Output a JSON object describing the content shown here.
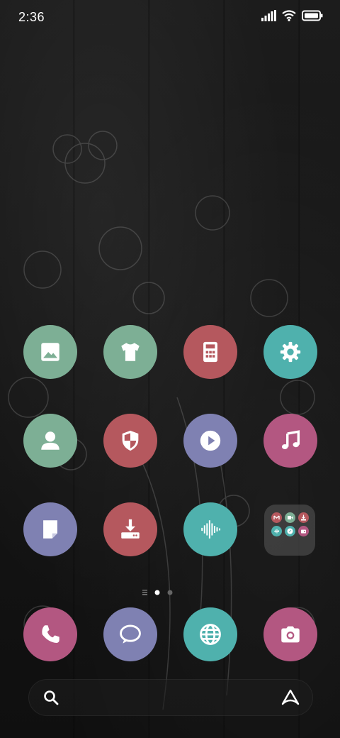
{
  "status_bar": {
    "time": "2:36",
    "icons": [
      "signal-icon",
      "wifi-icon",
      "battery-icon"
    ]
  },
  "colors": {
    "green": "#7daf95",
    "red": "#b5585e",
    "teal": "#4fb1ad",
    "purple": "#7f81b2",
    "pink": "#b35781"
  },
  "apps": [
    {
      "icon": "gallery-icon",
      "color": "#7daf95"
    },
    {
      "icon": "themes-icon",
      "color": "#7daf95"
    },
    {
      "icon": "calculator-icon",
      "color": "#b5585e"
    },
    {
      "icon": "settings-icon",
      "color": "#4fb1ad"
    },
    {
      "icon": "contacts-icon",
      "color": "#7daf95"
    },
    {
      "icon": "security-icon",
      "color": "#b5585e"
    },
    {
      "icon": "video-play-icon",
      "color": "#7f81b2"
    },
    {
      "icon": "music-icon",
      "color": "#b35781"
    },
    {
      "icon": "notes-icon",
      "color": "#7f81b2"
    },
    {
      "icon": "downloads-icon",
      "color": "#b5585e"
    },
    {
      "icon": "recorder-icon",
      "color": "#4fb1ad"
    }
  ],
  "folder": {
    "icons": [
      "mail-icon",
      "video-call-icon",
      "download-icon",
      "waves-icon",
      "compass-icon",
      "radio-icon"
    ]
  },
  "page_indicator": {
    "pages": 2,
    "current": 1
  },
  "dock": [
    {
      "icon": "phone-icon",
      "color": "#b35781"
    },
    {
      "icon": "messages-icon",
      "color": "#7f81b2"
    },
    {
      "icon": "browser-icon",
      "color": "#4fb1ad"
    },
    {
      "icon": "camera-icon",
      "color": "#b35781"
    }
  ],
  "search_bar": {
    "icons": [
      "search-icon",
      "assistant-icon"
    ]
  }
}
